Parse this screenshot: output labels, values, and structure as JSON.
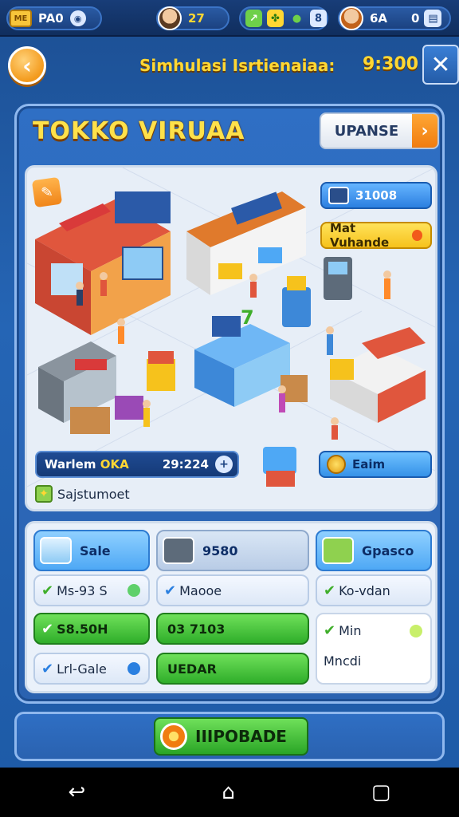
{
  "topbar": {
    "currency_label": "ME",
    "currency_value": "PA0",
    "level_value": "27",
    "mid_value": "8",
    "right_value": "6A",
    "right_value2": "0"
  },
  "header": {
    "title": "Simhulasi Isrtienaiaa:",
    "time": "9:300"
  },
  "shop": {
    "title": "TOKKO VIRUAA",
    "upanse_label": "UPANSE"
  },
  "scene": {
    "badge_top": "31008",
    "badge_yellow": "Mat Vuhande",
    "status_left": "Warlem",
    "status_left_bold": "OKA",
    "status_right": "29:224",
    "coin_label": "Eaim",
    "system_label": "Sajstumoet"
  },
  "cards": {
    "c1_head": "Sale",
    "c2_head": "9580",
    "c3_head": "Gpasco",
    "c1_sub": "Ms-93 S",
    "c2_sub": "Maooe",
    "c3_sub": "Ko-vdan",
    "c1_green": "S8.50H",
    "c2_green": "03 7103",
    "c3_white_top": "Min",
    "c3_white_bottom": "Mncdi",
    "c1_bottom": "Lrl-Gale",
    "c2_bottom": "UEDAR"
  },
  "bottom": {
    "upgrade_label": "IIIPOBADE"
  },
  "colors": {
    "accent_yellow": "#ffd733",
    "panel_blue": "#2f6fc4",
    "green": "#2fae2a"
  }
}
